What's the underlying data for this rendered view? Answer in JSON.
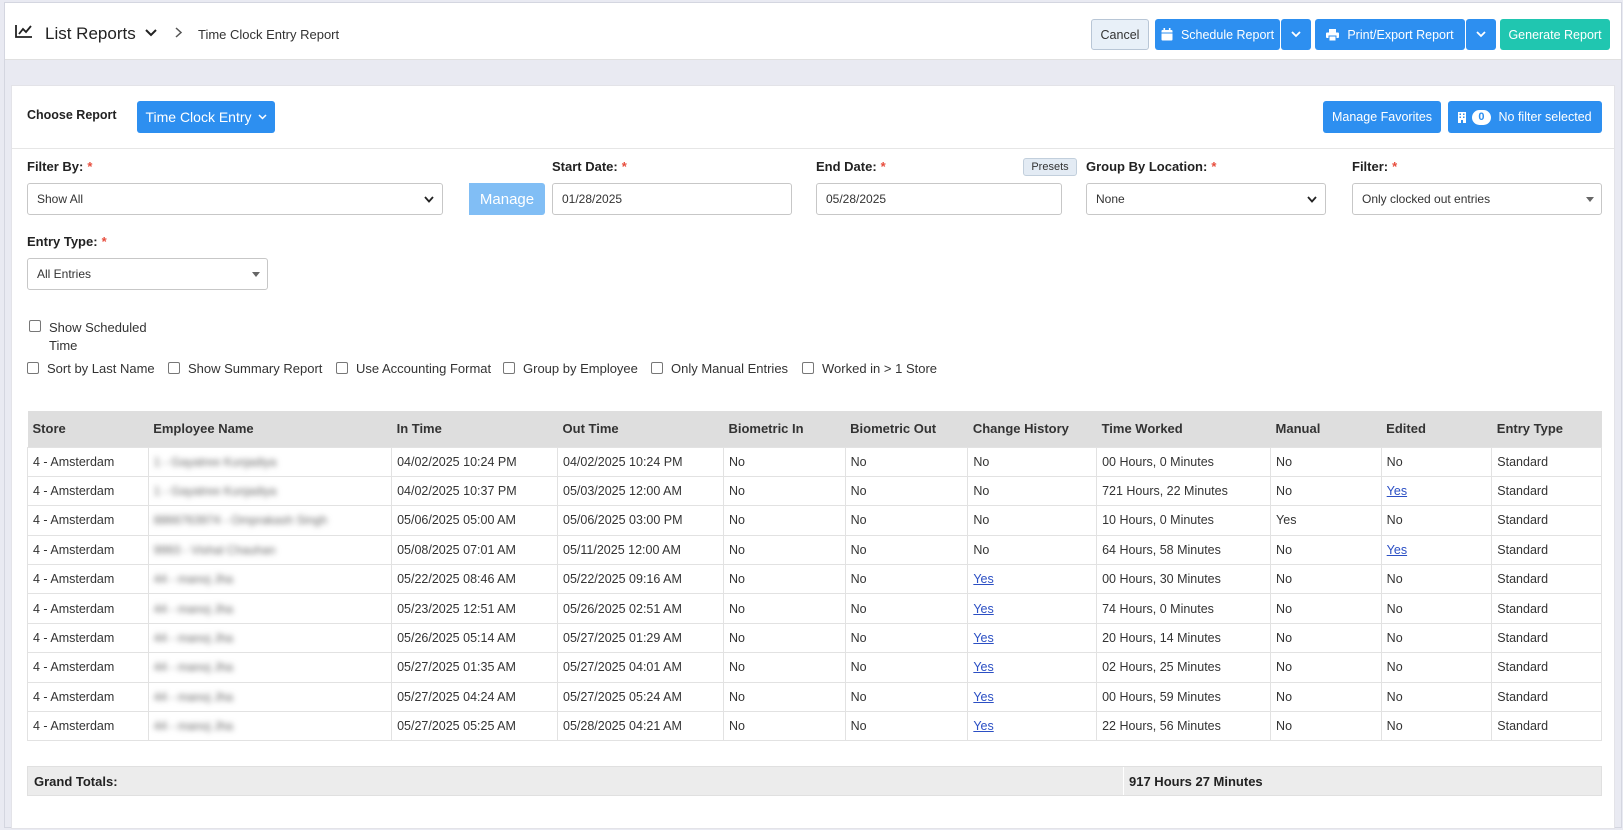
{
  "header": {
    "title": "List Reports",
    "breadcrumb": "Time Clock Entry Report",
    "cancel_label": "Cancel",
    "schedule_label": "Schedule Report",
    "print_label": "Print/Export Report",
    "generate_label": "Generate Report"
  },
  "toolbar": {
    "choose_label": "Choose Report",
    "report_selected": "Time Clock Entry",
    "favorites_label": "Manage Favorites",
    "filter_count": "0",
    "no_filter_label": "No filter selected"
  },
  "form": {
    "filter_by": {
      "label": "Filter By:",
      "value": "Show All",
      "manage_label": "Manage"
    },
    "start_date": {
      "label": "Start Date:",
      "value": "01/28/2025"
    },
    "end_date": {
      "label": "End Date:",
      "value": "05/28/2025",
      "presets_label": "Presets"
    },
    "group_by_location": {
      "label": "Group By Location:",
      "value": "None"
    },
    "filter": {
      "label": "Filter:",
      "value": "Only clocked out entries"
    },
    "entry_type": {
      "label": "Entry Type:",
      "value": "All Entries"
    },
    "required_mark": "*"
  },
  "checkboxes": {
    "show_scheduled_line1": "Show Scheduled",
    "show_scheduled_line2": "Time",
    "sort_last_name": "Sort by Last Name",
    "show_summary": "Show Summary Report",
    "accounting_format": "Use Accounting Format",
    "group_employee": "Group by Employee",
    "manual_entries": "Only Manual Entries",
    "worked_multi_store": "Worked in > 1 Store"
  },
  "table": {
    "columns": [
      "Store",
      "Employee Name",
      "In Time",
      "Out Time",
      "Biometric In",
      "Biometric Out",
      "Change History",
      "Time Worked",
      "Manual",
      "Edited",
      "Entry Type"
    ],
    "rows": [
      {
        "store": "4 - Amsterdam",
        "employee": "1 - Gayatree Kunjadiya",
        "in": "04/02/2025 10:24 PM",
        "out": "04/02/2025 10:24 PM",
        "bio_in": "No",
        "bio_out": "No",
        "history": "No",
        "worked": "00 Hours, 0 Minutes",
        "manual": "No",
        "edited": "No",
        "type": "Standard"
      },
      {
        "store": "4 - Amsterdam",
        "employee": "1 - Gayatree Kunjadiya",
        "in": "04/02/2025 10:37 PM",
        "out": "05/03/2025 12:00 AM",
        "bio_in": "No",
        "bio_out": "No",
        "history": "No",
        "worked": "721 Hours, 22 Minutes",
        "manual": "No",
        "edited": "Yes",
        "type": "Standard"
      },
      {
        "store": "4 - Amsterdam",
        "employee": "8866763974 - Omprakash Singh",
        "in": "05/06/2025 05:00 AM",
        "out": "05/06/2025 03:00 PM",
        "bio_in": "No",
        "bio_out": "No",
        "history": "No",
        "worked": "10 Hours, 0 Minutes",
        "manual": "Yes",
        "edited": "No",
        "type": "Standard"
      },
      {
        "store": "4 - Amsterdam",
        "employee": "9993 - Vishal Chauhan",
        "in": "05/08/2025 07:01 AM",
        "out": "05/11/2025 12:00 AM",
        "bio_in": "No",
        "bio_out": "No",
        "history": "No",
        "worked": "64 Hours, 58 Minutes",
        "manual": "No",
        "edited": "Yes",
        "type": "Standard"
      },
      {
        "store": "4 - Amsterdam",
        "employee": "44 - manoj Jha",
        "in": "05/22/2025 08:46 AM",
        "out": "05/22/2025 09:16 AM",
        "bio_in": "No",
        "bio_out": "No",
        "history": "Yes",
        "worked": "00 Hours, 30 Minutes",
        "manual": "No",
        "edited": "No",
        "type": "Standard"
      },
      {
        "store": "4 - Amsterdam",
        "employee": "44 - manoj Jha",
        "in": "05/23/2025 12:51 AM",
        "out": "05/26/2025 02:51 AM",
        "bio_in": "No",
        "bio_out": "No",
        "history": "Yes",
        "worked": "74 Hours, 0 Minutes",
        "manual": "No",
        "edited": "No",
        "type": "Standard"
      },
      {
        "store": "4 - Amsterdam",
        "employee": "44 - manoj Jha",
        "in": "05/26/2025 05:14 AM",
        "out": "05/27/2025 01:29 AM",
        "bio_in": "No",
        "bio_out": "No",
        "history": "Yes",
        "worked": "20 Hours, 14 Minutes",
        "manual": "No",
        "edited": "No",
        "type": "Standard"
      },
      {
        "store": "4 - Amsterdam",
        "employee": "44 - manoj Jha",
        "in": "05/27/2025 01:35 AM",
        "out": "05/27/2025 04:01 AM",
        "bio_in": "No",
        "bio_out": "No",
        "history": "Yes",
        "worked": "02 Hours, 25 Minutes",
        "manual": "No",
        "edited": "No",
        "type": "Standard"
      },
      {
        "store": "4 - Amsterdam",
        "employee": "44 - manoj Jha",
        "in": "05/27/2025 04:24 AM",
        "out": "05/27/2025 05:24 AM",
        "bio_in": "No",
        "bio_out": "No",
        "history": "Yes",
        "worked": "00 Hours, 59 Minutes",
        "manual": "No",
        "edited": "No",
        "type": "Standard"
      },
      {
        "store": "4 - Amsterdam",
        "employee": "44 - manoj Jha",
        "in": "05/27/2025 05:25 AM",
        "out": "05/28/2025 04:21 AM",
        "bio_in": "No",
        "bio_out": "No",
        "history": "Yes",
        "worked": "22 Hours, 56 Minutes",
        "manual": "No",
        "edited": "No",
        "type": "Standard"
      }
    ],
    "grand_label": "Grand Totals:",
    "grand_value": "917 Hours 27 Minutes"
  },
  "colors": {
    "primary": "#2d8ff0",
    "generate": "#20c6b0",
    "link": "#2b4fc4",
    "required": "#e74c3c"
  }
}
